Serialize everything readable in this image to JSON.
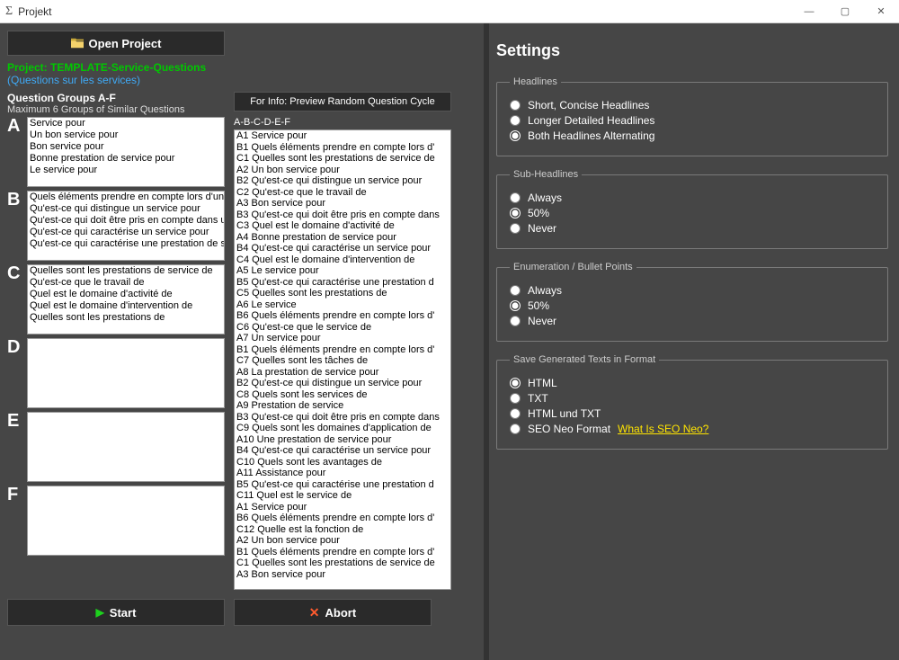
{
  "window": {
    "title": "Projekt",
    "min": "—",
    "max": "▢",
    "close": "✕"
  },
  "buttons": {
    "open": "Open Project",
    "preview": "For Info: Preview Random Question Cycle",
    "start": "Start",
    "abort": "Abort"
  },
  "project": {
    "name": "Project: TEMPLATE-Service-Questions",
    "sub": "(Questions sur les services)"
  },
  "groups_header": "Question Groups A-F",
  "groups_sub": "Maximum 6 Groups of Similar Questions",
  "abcdef_label": "A-B-C-D-E-F",
  "groups": [
    {
      "letter": "A",
      "lines": [
        "Service pour",
        "Un bon service pour",
        "Bon service pour",
        "Bonne prestation de service pour",
        "Le service pour"
      ]
    },
    {
      "letter": "B",
      "lines": [
        "Quels éléments prendre en compte lors d'un :",
        "Qu'est-ce qui distingue un service pour",
        "Qu'est-ce qui doit être pris en compte dans ur",
        "Qu'est-ce qui caractérise un service pour",
        "Qu'est-ce qui caractérise une prestation de s"
      ]
    },
    {
      "letter": "C",
      "lines": [
        "Quelles sont les prestations de service de",
        "Qu'est-ce que le travail de",
        "Quel est le domaine d'activité de",
        "Quel est le domaine d'intervention de",
        "Quelles sont les prestations de"
      ]
    },
    {
      "letter": "D",
      "lines": []
    },
    {
      "letter": "E",
      "lines": []
    },
    {
      "letter": "F",
      "lines": []
    }
  ],
  "preview_lines": [
    "A1 Service pour",
    "B1 Quels éléments prendre en compte lors d'",
    "C1 Quelles sont les prestations de service de",
    "A2 Un bon service pour",
    "B2 Qu'est-ce qui distingue un service pour",
    "C2 Qu'est-ce que le travail de",
    "A3 Bon service pour",
    "B3 Qu'est-ce qui doit être pris en compte dans",
    "C3 Quel est le domaine d'activité de",
    "A4 Bonne prestation de service pour",
    "B4 Qu'est-ce qui caractérise un service pour",
    "C4 Quel est le domaine d'intervention de",
    "A5 Le service pour",
    "B5 Qu'est-ce qui caractérise une prestation d",
    "C5 Quelles sont les prestations de",
    "A6 Le service",
    "B6 Quels éléments prendre en compte lors d'",
    "C6 Qu'est-ce que le service de",
    "A7 Un service pour",
    "B1 Quels éléments prendre en compte lors d'",
    "C7 Quelles sont les tâches de",
    "A8 La prestation de service pour",
    "B2 Qu'est-ce qui distingue un service pour",
    "C8 Quels sont les services de",
    "A9 Prestation de service",
    "B3 Qu'est-ce qui doit être pris en compte dans",
    "C9 Quels sont les domaines d'application de",
    "A10 Une prestation de service pour",
    "B4 Qu'est-ce qui caractérise un service pour",
    "C10 Quels sont les avantages de",
    "A11 Assistance pour",
    "B5 Qu'est-ce qui caractérise une prestation d",
    "C11 Quel est le service de",
    "A1 Service pour",
    "B6 Quels éléments prendre en compte lors d'",
    "C12 Quelle est la fonction de",
    "A2 Un bon service pour",
    "B1 Quels éléments prendre en compte lors d'",
    "C1 Quelles sont les prestations de service de",
    "A3 Bon service pour"
  ],
  "settings": {
    "title": "Settings",
    "headlines": {
      "legend": "Headlines",
      "options": [
        "Short, Concise Headlines",
        "Longer Detailed Headlines",
        "Both Headlines Alternating"
      ],
      "selected": 2
    },
    "subheadlines": {
      "legend": "Sub-Headlines",
      "options": [
        "Always",
        "50%",
        "Never"
      ],
      "selected": 1
    },
    "bullets": {
      "legend": "Enumeration / Bullet Points",
      "options": [
        "Always",
        "50%",
        "Never"
      ],
      "selected": 1
    },
    "save": {
      "legend": "Save Generated Texts in Format",
      "options": [
        "HTML",
        "TXT",
        "HTML und TXT",
        "SEO Neo Format"
      ],
      "selected": 0,
      "link": "What Is SEO Neo?"
    }
  }
}
